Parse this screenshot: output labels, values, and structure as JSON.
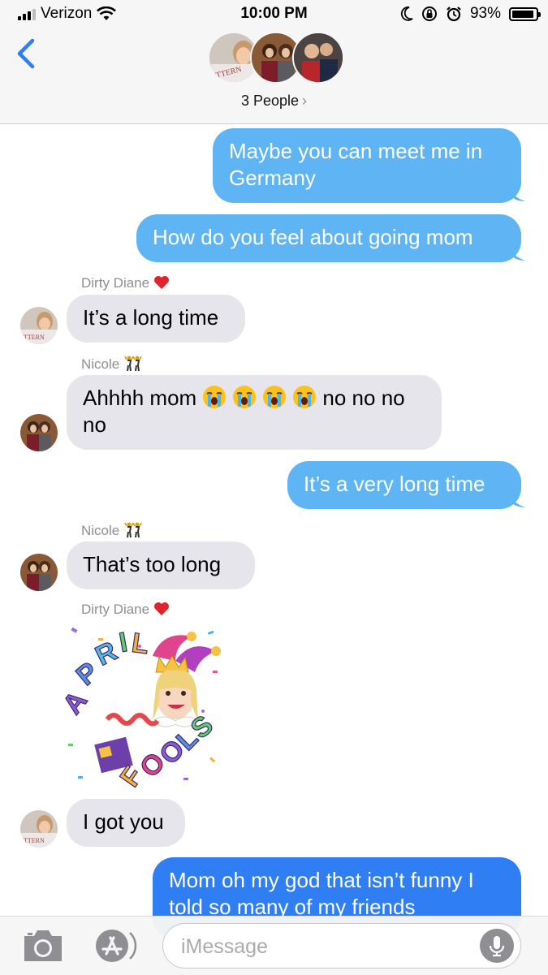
{
  "status_bar": {
    "carrier": "Verizon",
    "time": "10:00 PM",
    "battery": "93%",
    "battery_level": 0.93
  },
  "header": {
    "title": "3 People",
    "chevron": "›",
    "icons": [
      "back-chevron-icon",
      "group-avatar-icon"
    ]
  },
  "messages": [
    {
      "id": "m1",
      "direction": "outgoing",
      "text": "Maybe you can meet me in Germany"
    },
    {
      "id": "m2",
      "direction": "outgoing",
      "text": "How do you feel about going mom"
    },
    {
      "id": "m3",
      "direction": "incoming",
      "sender": "Dirty Diane",
      "sender_emoji": "heart",
      "text": "It’s a long time"
    },
    {
      "id": "m4",
      "direction": "incoming",
      "sender": "Nicole",
      "sender_emoji": "dancers",
      "text_before": "Ahhhh mom ",
      "emoji": "loudly-crying-face",
      "emoji_count": 4,
      "text_after": "no no no no"
    },
    {
      "id": "m5",
      "direction": "outgoing",
      "text": "It’s a very long time"
    },
    {
      "id": "m6",
      "direction": "incoming",
      "sender": "Nicole",
      "sender_emoji": "dancers",
      "text": "That’s too long"
    },
    {
      "id": "m7",
      "direction": "incoming",
      "sender": "Dirty Diane",
      "sender_emoji": "heart",
      "sticker": "April Fools"
    },
    {
      "id": "m8",
      "direction": "incoming",
      "text": "I got you"
    },
    {
      "id": "m9",
      "direction": "outgoing",
      "style": "imessage",
      "text": "Mom oh my god that isn’t funny I told so many of my friends"
    }
  ],
  "input_bar": {
    "placeholder": "iMessage",
    "icons": [
      "camera-icon",
      "app-store-icon",
      "microphone-icon"
    ]
  },
  "colors": {
    "outgoing_bubble": "#5fb4f4",
    "imessage_bubble": "#2f7ef4",
    "incoming_bubble": "#e6e5eb",
    "accent": "#2f7ef4"
  }
}
